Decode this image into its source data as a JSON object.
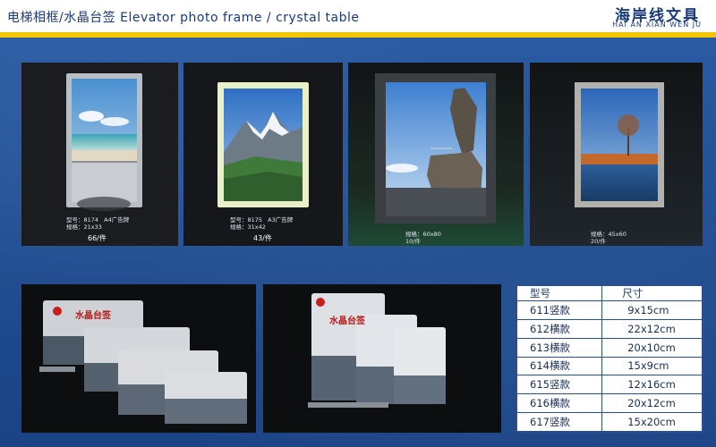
{
  "header": {
    "title": "电梯相框/水晶台签  Elevator photo frame / crystal table",
    "brand_cn": "海岸线文具",
    "brand_en": "HAI AN XIAN WEN JU"
  },
  "colors": {
    "header_bg": "#ffffff",
    "header_text": "#1a3a78",
    "accent_rule": "#f2c600",
    "page_bg": "#1f4d8f"
  },
  "products": [
    {
      "model": "型号：8174",
      "size": "规格：21x33",
      "note": "A4广告牌",
      "price": "66/件"
    },
    {
      "model": "型号：8175",
      "size": "规格：31x42",
      "note": "A3广告牌",
      "price": "43/件"
    },
    {
      "size": "规格：60x80",
      "price": "10/件"
    },
    {
      "size": "规格：45x60",
      "price": "20/件"
    }
  ],
  "crystal": {
    "sign_label": "水晶台签"
  },
  "spec_table": {
    "headers": [
      "型号",
      "尺寸"
    ],
    "rows": [
      [
        "611竖款",
        "9x15cm"
      ],
      [
        "612横款",
        "22x12cm"
      ],
      [
        "613横款",
        "20x10cm"
      ],
      [
        "614横款",
        "15x9cm"
      ],
      [
        "615竖款",
        "12x16cm"
      ],
      [
        "616横款",
        "20x12cm"
      ],
      [
        "617竖款",
        "15x20cm"
      ]
    ]
  }
}
